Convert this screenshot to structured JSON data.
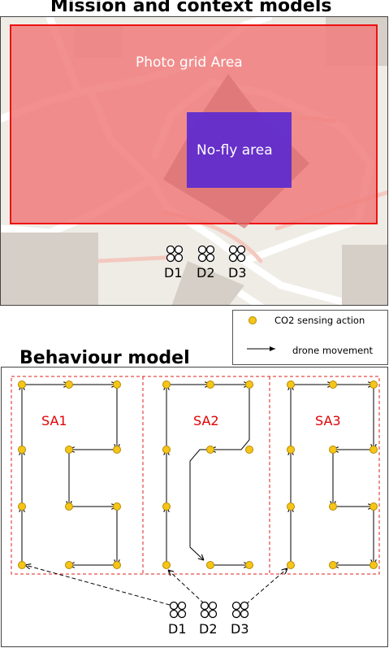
{
  "titles": {
    "top": "Mission and context models",
    "bottom": "Behaviour model"
  },
  "map": {
    "photo_grid_label": "Photo grid Area",
    "nofly_label": "No-fly area",
    "colors": {
      "photo_grid": "#f08080",
      "nofly": "#5b2ad0",
      "background": "#efece6",
      "roads": "#f3c9bf"
    }
  },
  "legend": {
    "co2_label": "CO2 sensing action",
    "move_label": "drone movement",
    "dot_color": "#f5c518"
  },
  "behaviour": {
    "sa_labels": [
      "SA1",
      "SA2",
      "SA3"
    ],
    "sa_color": "#e00000"
  },
  "drones": {
    "top": [
      "D1",
      "D2",
      "D3"
    ],
    "bottom": [
      "D1",
      "D2",
      "D3"
    ]
  }
}
